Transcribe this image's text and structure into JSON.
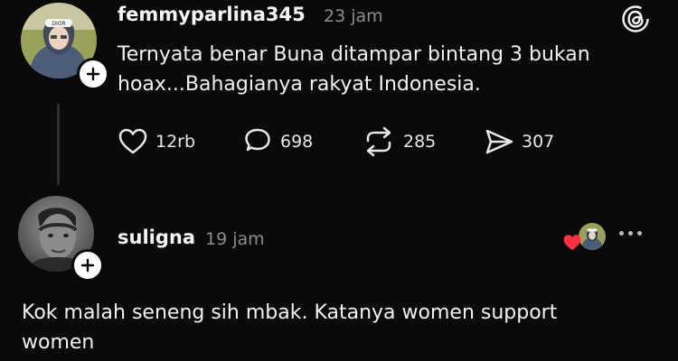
{
  "post": {
    "username": "femmyparlina345",
    "time": "23 jam",
    "text_line1": "Ternyata benar Buna ditampar bintang 3 bukan",
    "text_line2": "hoax...Bahagianya rakyat Indonesia.",
    "actions": {
      "likes": "12rb",
      "comments": "698",
      "reposts": "285",
      "shares": "307"
    }
  },
  "reply": {
    "username": "suligna",
    "time": "19 jam",
    "text_line1": "Kok malah seneng sih mbak. Katanya women support",
    "text_line2": "women"
  },
  "icons": {
    "app": "threads-icon",
    "like": "heart-icon",
    "comment": "comment-icon",
    "repost": "repost-icon",
    "share": "send-icon",
    "more": "more-icon"
  },
  "colors": {
    "background": "#0a0a0a",
    "heart": "#ff3040",
    "muted": "#8d8d8d"
  }
}
